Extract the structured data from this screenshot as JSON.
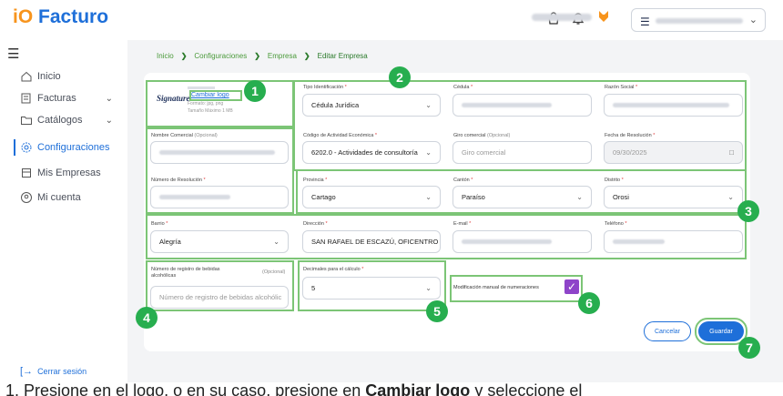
{
  "app": {
    "logo_io": "iO",
    "logo_name": "Facturo"
  },
  "topbar": {
    "icons": [
      "bag-icon",
      "bell-icon"
    ],
    "company_menu_icon": "hamburger-icon"
  },
  "sidebar": {
    "items": [
      {
        "label": "Inicio",
        "icon": "home-icon"
      },
      {
        "label": "Facturas",
        "icon": "invoice-icon",
        "expandable": true
      },
      {
        "label": "Catálogos",
        "icon": "folder-icon",
        "expandable": true
      },
      {
        "label": "Configuraciones",
        "icon": "gear-icon",
        "active": true
      },
      {
        "label": "Mis Empresas",
        "icon": "building-icon"
      },
      {
        "label": "Mi cuenta",
        "icon": "user-icon"
      }
    ],
    "logout": "Cerrar sesión"
  },
  "breadcrumb": [
    "Inicio",
    "Configuraciones",
    "Empresa",
    "Editar Empresa"
  ],
  "logo_section": {
    "logo_text": "Signature",
    "change_link": "Cambiar logo",
    "format_note": "Formato: jpg, png",
    "size_note": "Tamaño Máximo 1 MB"
  },
  "form": {
    "tipo_identificacion": {
      "label": "Tipo Identificación",
      "value": "Cédula Jurídica"
    },
    "cedula": {
      "label": "Cédula"
    },
    "razon_social": {
      "label": "Razón Social"
    },
    "nombre_comercial": {
      "label": "Nombre Comercial",
      "optional": "(Opcional)"
    },
    "codigo_actividad": {
      "label": "Código de Actividad Económica",
      "value": "6202.0 - Actividades de consultoría"
    },
    "giro_comercial": {
      "label": "Giro comercial",
      "optional": "(Opcional)",
      "placeholder": "Giro comercial"
    },
    "fecha_resolucion": {
      "label": "Fecha de Resolución",
      "value": "09/30/2025"
    },
    "numero_resolucion": {
      "label": "Número de Resolución"
    },
    "provincia": {
      "label": "Provincia",
      "value": "Cartago"
    },
    "canton": {
      "label": "Cantón",
      "value": "Paraíso"
    },
    "distrito": {
      "label": "Distrito",
      "value": "Orosi"
    },
    "barrio": {
      "label": "Barrio",
      "value": "Alegría"
    },
    "direccion": {
      "label": "Dirección",
      "value": "SAN RAFAEL DE ESCAZÚ, OFICENTRO PL..."
    },
    "email": {
      "label": "E-mail"
    },
    "telefono": {
      "label": "Teléfono"
    },
    "registro_bebidas": {
      "label_line1": "Número de registro de bebidas",
      "label_line2": "alcohólicas",
      "optional": "(Opcional)",
      "placeholder": "Número de registro de bebidas alcohólic"
    },
    "decimales": {
      "label": "Decimales para el cálculo",
      "value": "5"
    },
    "modificacion_manual": {
      "label": "Modificación manual de numeraciones",
      "checked": true
    }
  },
  "actions": {
    "cancel": "Cancelar",
    "save": "Guardar"
  },
  "badges": [
    "1",
    "2",
    "3",
    "4",
    "5",
    "6",
    "7"
  ],
  "caption": {
    "text_before": "1.  Presione en el logo, o en su caso, presione en",
    "bold": "Cambiar logo",
    "text_after": "y seleccione el"
  },
  "colors": {
    "accent": "#1e6fd9",
    "highlight": "#7cc576",
    "badge": "#27ae4f",
    "checkbox": "#8e44c9",
    "required": "#e03b3b"
  }
}
